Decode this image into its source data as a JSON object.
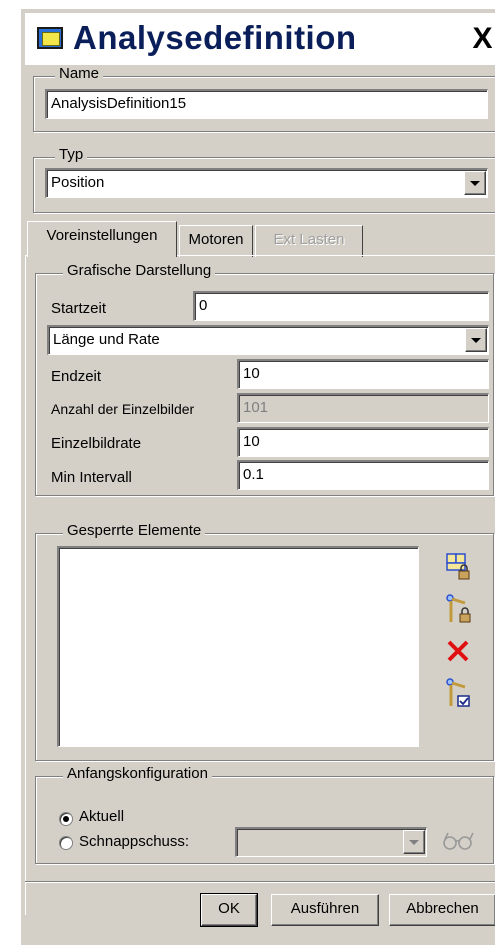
{
  "window": {
    "title": "Analysedefinition",
    "close_label": "X"
  },
  "name_group": {
    "legend": "Name",
    "value": "AnalysisDefinition15"
  },
  "type_group": {
    "legend": "Typ",
    "selected": "Position"
  },
  "tabs": [
    {
      "label": "Voreinstellungen",
      "active": true,
      "enabled": true
    },
    {
      "label": "Motoren",
      "active": false,
      "enabled": true
    },
    {
      "label": "Ext Lasten",
      "active": false,
      "enabled": false
    }
  ],
  "graphics": {
    "legend": "Grafische Darstellung",
    "start_label": "Startzeit",
    "start_value": "0",
    "mode_selected": "Länge und Rate",
    "end_label": "Endzeit",
    "end_value": "10",
    "frames_label": "Anzahl der Einzelbilder",
    "frames_value": "101",
    "rate_label": "Einzelbildrate",
    "rate_value": "10",
    "interval_label": "Min Intervall",
    "interval_value": "0.1"
  },
  "locked": {
    "legend": "Gesperrte Elemente",
    "icons": [
      "lock-component-icon",
      "lock-body-icon",
      "delete-icon",
      "enable-connection-icon"
    ]
  },
  "initial": {
    "legend": "Anfangskonfiguration",
    "current_label": "Aktuell",
    "snapshot_label": "Schnappschuss:",
    "selected": "current"
  },
  "buttons": {
    "ok": "OK",
    "run": "Ausführen",
    "cancel": "Abbrechen"
  },
  "colors": {
    "face": "#d4d0c8",
    "title_text": "#0a1e5a",
    "delete_red": "#e01010"
  }
}
